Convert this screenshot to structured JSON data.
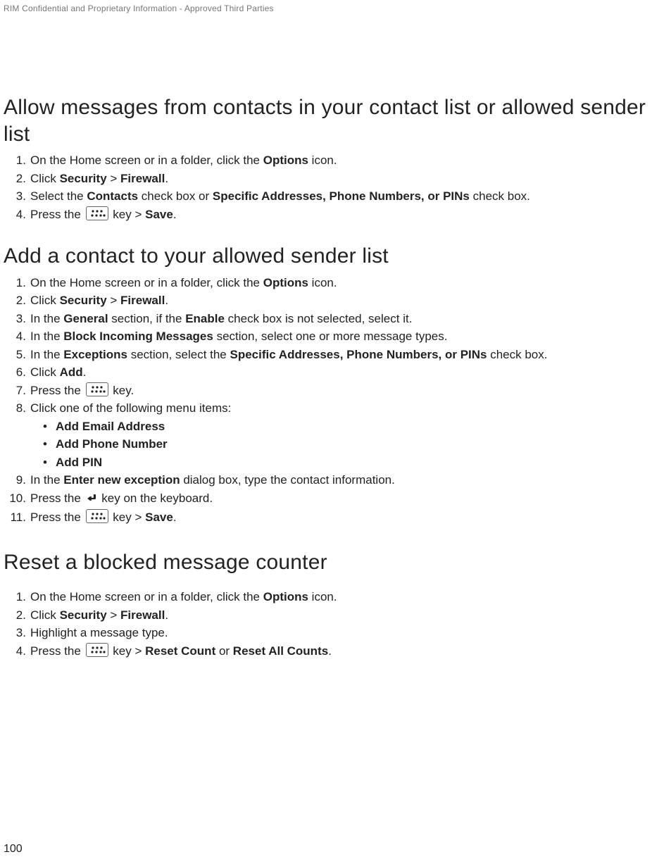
{
  "header": "RIM Confidential and Proprietary Information - Approved Third Parties",
  "pageNumber": "100",
  "sec1": {
    "title": "Allow messages from contacts in your contact list or allowed sender list",
    "s1_a": "On the Home screen or in a folder, click the ",
    "s1_b": "Options",
    "s1_c": " icon.",
    "s2_a": "Click ",
    "s2_b": "Security",
    "s2_c": " > ",
    "s2_d": "Firewall",
    "s2_e": ".",
    "s3_a": "Select the ",
    "s3_b": "Contacts",
    "s3_c": " check box or ",
    "s3_d": "Specific Addresses, Phone Numbers, or PINs",
    "s3_e": " check box.",
    "s4_a": "Press the ",
    "s4_b": " key > ",
    "s4_c": "Save",
    "s4_d": "."
  },
  "sec2": {
    "title": "Add a contact to your allowed sender list",
    "s1_a": "On the Home screen or in a folder, click the ",
    "s1_b": "Options",
    "s1_c": " icon.",
    "s2_a": "Click ",
    "s2_b": "Security",
    "s2_c": " > ",
    "s2_d": "Firewall",
    "s2_e": ".",
    "s3_a": "In the ",
    "s3_b": "General",
    "s3_c": " section, if the ",
    "s3_d": "Enable",
    "s3_e": " check box is not selected, select it.",
    "s4_a": "In the ",
    "s4_b": "Block Incoming Messages",
    "s4_c": " section, select one or more message types.",
    "s5_a": "In the ",
    "s5_b": "Exceptions",
    "s5_c": " section, select the ",
    "s5_d": "Specific Addresses, Phone Numbers, or PINs",
    "s5_e": " check box.",
    "s6_a": "Click ",
    "s6_b": "Add",
    "s6_c": ".",
    "s7_a": "Press the ",
    "s7_b": " key.",
    "s8_a": "Click one of the following menu items:",
    "s8_i1": "Add Email Address",
    "s8_i2": "Add Phone Number",
    "s8_i3": "Add PIN",
    "s9_a": "In the ",
    "s9_b": "Enter new exception",
    "s9_c": " dialog box, type the contact information.",
    "s10_a": "Press the ",
    "s10_b": " key on the keyboard.",
    "s11_a": "Press the ",
    "s11_b": " key > ",
    "s11_c": "Save",
    "s11_d": "."
  },
  "sec3": {
    "title": "Reset a blocked message counter",
    "s1_a": "On the Home screen or in a folder, click the ",
    "s1_b": "Options",
    "s1_c": " icon.",
    "s2_a": "Click ",
    "s2_b": "Security",
    "s2_c": " > ",
    "s2_d": "Firewall",
    "s2_e": ".",
    "s3_a": "Highlight a message type.",
    "s4_a": "Press the ",
    "s4_b": " key > ",
    "s4_c": "Reset Count",
    "s4_d": " or ",
    "s4_e": "Reset All Counts",
    "s4_f": "."
  },
  "nums": {
    "n1": "1",
    "n2": "2",
    "n3": "3",
    "n4": "4",
    "n5": "5",
    "n6": "6",
    "n7": "7",
    "n8": "8",
    "n9": "9",
    "n10": "10",
    "n11": "11"
  }
}
